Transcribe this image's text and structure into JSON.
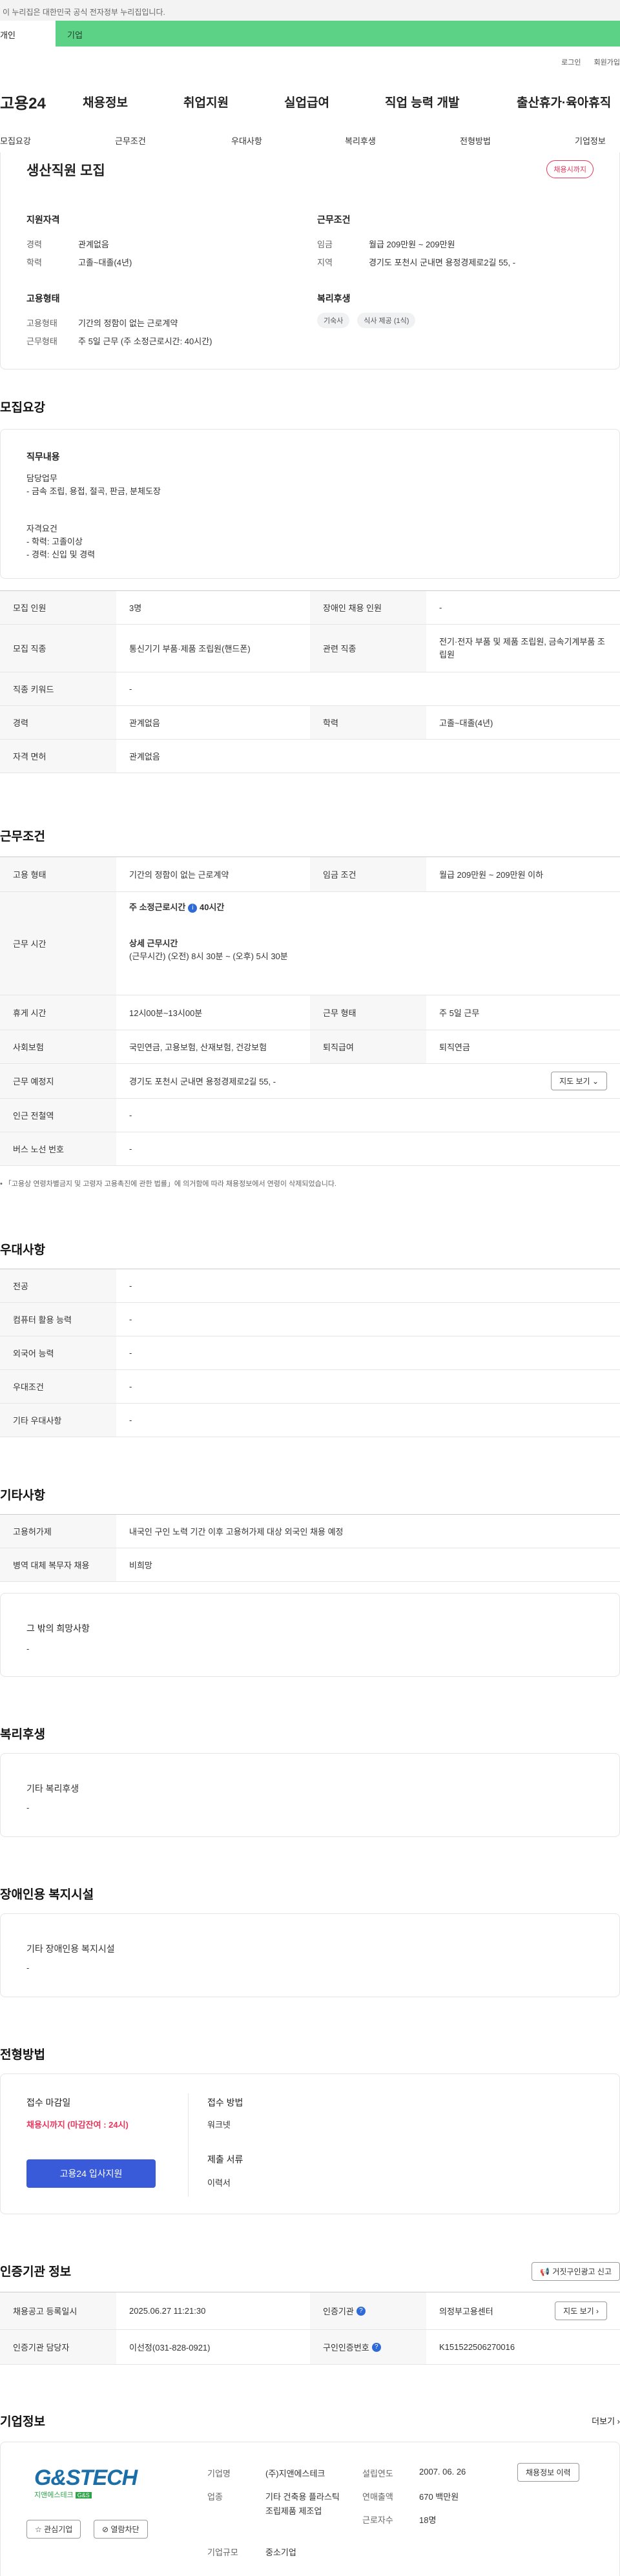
{
  "gov_bar": {
    "text": "이 누리집은 대한민국 공식 전자정부 누리집입니다."
  },
  "tabs": {
    "personal": "개인",
    "company": "기업"
  },
  "util": {
    "login": "로그인",
    "signup": "회원가입"
  },
  "gnb": {
    "logo": "고용24",
    "items": [
      "채용정보",
      "취업지원",
      "실업급여",
      "직업 능력 개발",
      "출산휴가·육아휴직"
    ]
  },
  "subnav": {
    "items": [
      "모집요강",
      "근무조건",
      "우대사항",
      "복리후생",
      "전형방법",
      "기업정보"
    ]
  },
  "summary": {
    "title": "생산직원 모집",
    "deadline_badge": "채용시까지",
    "qual_title": "지원자격",
    "qual_rows": [
      {
        "label": "경력",
        "value": "관계없음"
      },
      {
        "label": "학력",
        "value": "고졸~대졸(4년)"
      }
    ],
    "cond_title": "근무조건",
    "cond_rows": [
      {
        "label": "임금",
        "value": "월급 209만원 ~ 209만원"
      },
      {
        "label": "지역",
        "value": "경기도 포천시 군내면 용정경제로2길 55, -"
      }
    ],
    "emp_title": "고용형태",
    "emp_rows": [
      {
        "label": "고용형태",
        "value": "기간의 정함이 없는 근로계약"
      },
      {
        "label": "근무형태",
        "value": "주 5일 근무 (주 소정근로시간: 40시간)"
      }
    ],
    "welfare_title": "복리후생",
    "welfare_chips": [
      "기숙사",
      "식사 제공 (1식)"
    ]
  },
  "recruit": {
    "title": "모집요강",
    "job_title": "직무내용",
    "job_lines": [
      "담당업무",
      "- 금속 조립, 용접, 절곡, 판금, 분체도장"
    ],
    "req_lines": [
      "자격요건",
      "- 학력: 고졸이상",
      "- 경력: 신입 및 경력"
    ],
    "rows": [
      {
        "th1": "모집 인원",
        "td1": "3명",
        "th2": "장애인 채용 인원",
        "td2": "-"
      },
      {
        "th1": "모집 직종",
        "td1": "통신기기 부품·제품 조립원(핸드폰)",
        "th2": "관련 직종",
        "td2": "전기·전자 부품 및 제품 조립원, 금속기계부품 조립원"
      },
      {
        "th1": "직종 키워드",
        "td1": "-"
      },
      {
        "th1": "경력",
        "td1": "관계없음",
        "th2": "학력",
        "td2": "고졸~대졸(4년)"
      },
      {
        "th1": "자격 면허",
        "td1": "관계없음"
      }
    ]
  },
  "work": {
    "title": "근무조건",
    "emp_type_label": "고용 형태",
    "emp_type_value": "기간의 정함이 없는 근로계약",
    "wage_label": "임금 조건",
    "wage_value": "월급 209만원 ~ 209만원 이하",
    "hours_label": "근무 시간",
    "hours_weekly": "주 소정근로시간",
    "hours_weekly_value": "40시간",
    "hours_detail_title": "상세 근무시간",
    "hours_detail": "(근무시간) (오전) 8시 30분 ~ (오후) 5시 30분",
    "rows": [
      {
        "th1": "휴게 시간",
        "td1": "12시00분~13시00분",
        "th2": "근무 형태",
        "td2": "주 5일 근무"
      },
      {
        "th1": "사회보험",
        "td1": "국민연금, 고용보험, 산재보험, 건강보험",
        "th2": "퇴직급여",
        "td2": "퇴직연금"
      }
    ],
    "location_label": "근무 예정지",
    "location_value": "경기도 포천시 군내면 용정경제로2길 55, -",
    "map_button": "지도 보기",
    "station_label": "인근 전철역",
    "station_value": "-",
    "bus_label": "버스 노선 번호",
    "bus_value": "-",
    "notice": "「고용상 연령차별금지 및 고령자 고용촉진에 관한 법률」에 의거함에 따라 채용정보에서 연령이 삭제되었습니다."
  },
  "pref": {
    "title": "우대사항",
    "rows": [
      {
        "th": "전공",
        "td": "-"
      },
      {
        "th": "컴퓨터 활용 능력",
        "td": "-"
      },
      {
        "th": "외국어 능력",
        "td": "-"
      },
      {
        "th": "우대조건",
        "td": "-"
      },
      {
        "th": "기타 우대사항",
        "td": "-"
      }
    ]
  },
  "etc": {
    "title": "기타사항",
    "rows": [
      {
        "th": "고용허가제",
        "td": "내국인 구인 노력 기간 이후 고용허가제 대상 외국인 채용 예정"
      },
      {
        "th": "병역 대체 복무자 채용",
        "td": "비희망"
      }
    ],
    "other_title": "그 밖의 희망사항",
    "other_value": "-"
  },
  "welfare": {
    "title": "복리후생",
    "sub": "기타 복리후생",
    "value": "-"
  },
  "disability": {
    "title": "장애인용 복지시설",
    "sub": "기타 장애인용 복지시설",
    "value": "-"
  },
  "selection": {
    "title": "전형방법",
    "deadline_label": "접수 마감일",
    "deadline_value": "채용시까지 (마감잔여 : 24시)",
    "apply_button": "고용24 입사지원",
    "method_label": "접수 방법",
    "method_value": "워크넷",
    "docs_label": "제출 서류",
    "docs_value": "이력서"
  },
  "auth": {
    "title": "인증기관 정보",
    "report_button": "거짓구인광고 신고",
    "rows": [
      {
        "th1": "채용공고 등록일시",
        "td1": "2025.06.27 11:21:30",
        "th2": "인증기관",
        "td2": "의정부고용센터",
        "btn": "지도 보기"
      },
      {
        "th1": "인증기관 담당자",
        "td1": "이선정(031-828-0921)",
        "th2": "구인인증번호",
        "td2": "K151522506270016"
      }
    ]
  },
  "company": {
    "title": "기업정보",
    "more": "더보기",
    "logo_main": "G&STECH",
    "logo_sub": "지앤에스테크",
    "logo_tag": "G&S",
    "interest_button": "관심기업",
    "block_button": "열람차단",
    "name_label": "기업명",
    "name_value": "(주)지앤에스테크",
    "industry_label": "업종",
    "industry_value": "기타 건축용 플라스틱 조립제품 제조업",
    "size_label": "기업규모",
    "size_value": "중소기업",
    "founded_label": "설립연도",
    "founded_value": "2007. 06. 26",
    "sales_label": "연매출액",
    "sales_value": "670 백만원",
    "employees_label": "근로자수",
    "employees_value": "18명",
    "jobs_button": "채용정보 이력"
  },
  "colors": {
    "accent": "#3a5bd9",
    "green": "#5cd286",
    "pink": "#e8365d"
  }
}
